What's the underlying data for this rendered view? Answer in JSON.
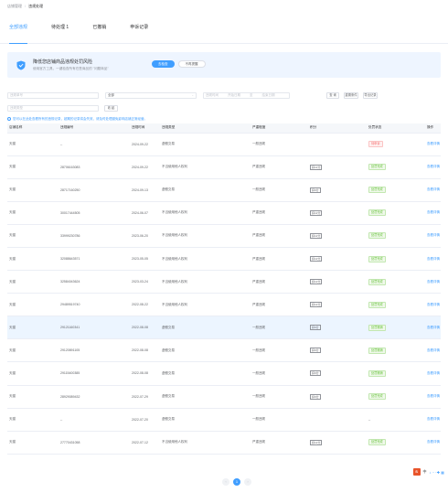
{
  "breadcrumb": {
    "parent": "店铺管理",
    "current": "违规处理"
  },
  "tabs": [
    {
      "label": "全部违规"
    },
    {
      "label": "待处理 1"
    },
    {
      "label": "已撤销"
    },
    {
      "label": "申诉记录"
    }
  ],
  "banner": {
    "title": "降低您店铺商品违规处罚风险",
    "subtitle": "使用官方工具，一键检查所有在售商品的 \"问题商品\"",
    "primary_btn": "去检查",
    "secondary_btn": "不再提醒"
  },
  "filters": {
    "order_no": "违规单号",
    "status": "全部",
    "time_label": "违规时间",
    "date_start": "开始日期",
    "date_sep": "至",
    "date_end": "结束日期",
    "search_btn": "查 询",
    "reset_btn": "重置条件",
    "export_btn": "导出记录",
    "item_type": "违规类型",
    "more_btn": "收 起"
  },
  "tip": "您可以在此处查看所有的违规记录，超期的记录将会失效，请及时处理避免影响店铺正常经营。",
  "table": {
    "headers": [
      "店铺名称",
      "违规编号",
      "违规时间",
      "违规类型",
      "严重程度",
      "积分",
      "处罚状态",
      "操作"
    ],
    "rows": [
      {
        "shop": "天猫",
        "no": "--",
        "time": "2024-09-22",
        "type": "虚假交易",
        "level": "一般违规",
        "tag": "",
        "status": "待申诉",
        "status_type": "red",
        "action": "查看详情"
      },
      {
        "shop": "天猫",
        "no": "28706163083",
        "time": "2024-09-22",
        "type": "不当使用他人权利",
        "level": "严重违规",
        "tag": "扣12分",
        "status": "处罚完成",
        "status_type": "green",
        "action": "查看详情"
      },
      {
        "shop": "天猫",
        "no": "28717160250",
        "time": "2024-09-13",
        "type": "虚假交易",
        "level": "一般违规",
        "tag": "扣6分",
        "status": "处罚完成",
        "status_type": "green",
        "action": "查看详情"
      },
      {
        "shop": "天猫",
        "no": "30017444505",
        "time": "2024-06-07",
        "type": "不当使用他人权利",
        "level": "严重违规",
        "tag": "扣12分",
        "status": "处罚完成",
        "status_type": "green",
        "action": "查看详情"
      },
      {
        "shop": "天猫",
        "no": "33999230786",
        "time": "2023-06-20",
        "type": "不当使用他人权利",
        "level": "严重违规",
        "tag": "扣12分",
        "status": "处罚完成",
        "status_type": "green",
        "action": "查看详情"
      },
      {
        "shop": "天猫",
        "no": "32088643571",
        "time": "2023-05-05",
        "type": "不当使用他人权利",
        "level": "严重违规",
        "tag": "扣12分",
        "status": "处罚完成",
        "status_type": "green",
        "action": "查看详情"
      },
      {
        "shop": "天猫",
        "no": "32584043624",
        "time": "2023-03-24",
        "type": "不当使用他人权利",
        "level": "严重违规",
        "tag": "扣12分",
        "status": "处罚完成",
        "status_type": "green",
        "action": "查看详情"
      },
      {
        "shop": "天猫",
        "no": "29489519740",
        "time": "2022-08-22",
        "type": "不当使用他人权利",
        "level": "严重违规",
        "tag": "扣12分",
        "status": "处罚完成",
        "status_type": "green",
        "action": "查看详情"
      },
      {
        "shop": "天猫",
        "no": "29121160341",
        "time": "2022-08-08",
        "type": "虚假交易",
        "level": "一般违规",
        "tag": "扣6分",
        "status": "处罚撤销",
        "status_type": "green",
        "action": "查看详情"
      },
      {
        "shop": "天猫",
        "no": "29120891105",
        "time": "2022-08-08",
        "type": "虚假交易",
        "level": "一般违规",
        "tag": "扣6分",
        "status": "处罚撤销",
        "status_type": "green",
        "action": "查看详情"
      },
      {
        "shop": "天猫",
        "no": "29115400385",
        "time": "2022-08-08",
        "type": "虚假交易",
        "level": "一般违规",
        "tag": "扣6分",
        "status": "处罚撤销",
        "status_type": "green",
        "action": "查看详情"
      },
      {
        "shop": "天猫",
        "no": "28929089432",
        "time": "2022-07-29",
        "type": "虚假交易",
        "level": "一般违规",
        "tag": "扣6分",
        "status": "处罚完成",
        "status_type": "green",
        "action": "查看详情"
      },
      {
        "shop": "天猫",
        "no": "--",
        "time": "2022-07-20",
        "type": "虚假交易",
        "level": "一般违规",
        "tag": "",
        "status": "--",
        "status_type": "",
        "action": "查看详情"
      },
      {
        "shop": "天猫",
        "no": "27770431058",
        "time": "2022-07-12",
        "type": "不当使用他人权利",
        "level": "严重违规",
        "tag": "扣12分",
        "status": "处罚完成",
        "status_type": "green",
        "action": "查看详情"
      }
    ],
    "highlight_row": 8
  },
  "pager": {
    "prev": "‹",
    "current": "1",
    "next": "›"
  },
  "tray": {
    "logo": "S",
    "lang": "中",
    "icons": "♪ ⋯ ✚ ▦"
  }
}
